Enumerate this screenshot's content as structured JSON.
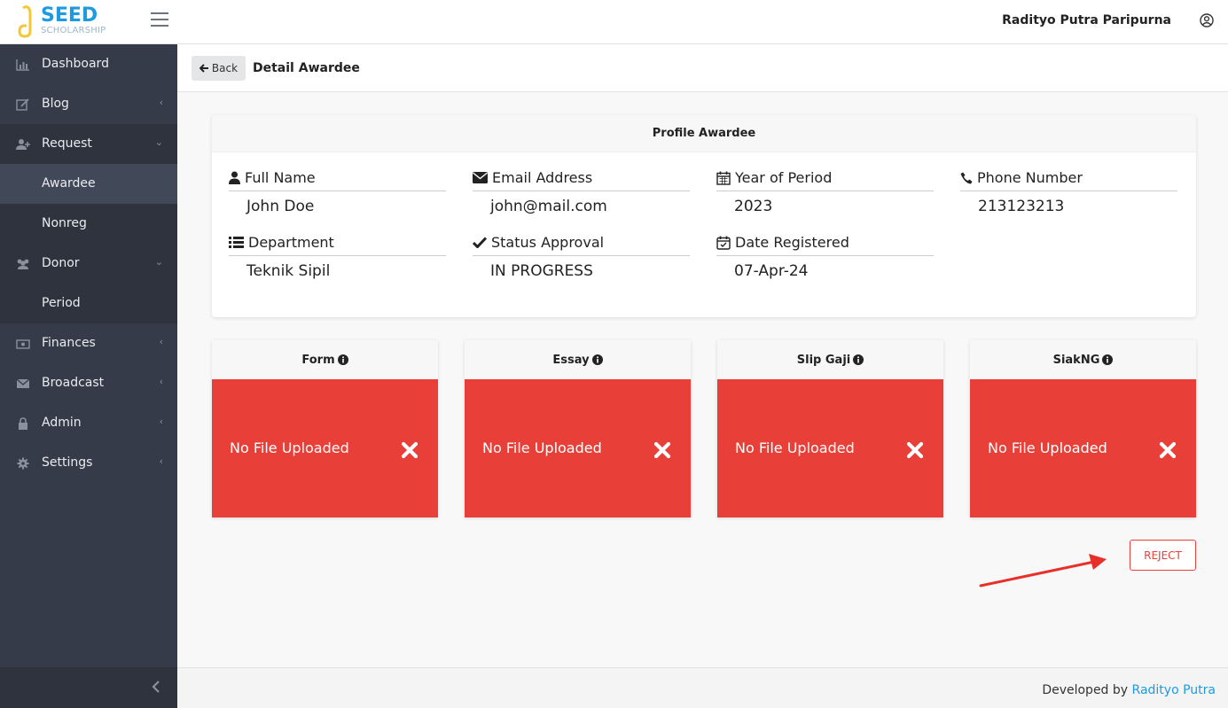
{
  "header": {
    "logo_main": "SEED",
    "logo_sub": "SCHOLARSHIP",
    "user_name": "Radityo Putra Paripurna"
  },
  "sidebar": {
    "items": [
      {
        "label": "Dashboard",
        "icon": "bar-chart-icon"
      },
      {
        "label": "Blog",
        "icon": "edit-icon"
      },
      {
        "label": "Request",
        "icon": "user-plus-icon"
      },
      {
        "label": "Awardee"
      },
      {
        "label": "Nonreg"
      },
      {
        "label": "Donor",
        "icon": "users-icon"
      },
      {
        "label": "Period"
      },
      {
        "label": "Finances",
        "icon": "money-icon"
      },
      {
        "label": "Broadcast",
        "icon": "envelope-icon"
      },
      {
        "label": "Admin",
        "icon": "lock-icon"
      },
      {
        "label": "Settings",
        "icon": "gear-icon"
      }
    ]
  },
  "subheader": {
    "back_label": "Back",
    "title": "Detail Awardee"
  },
  "profile": {
    "title": "Profile Awardee",
    "fields": [
      {
        "label": "Full Name",
        "value": "John Doe",
        "icon": "user-icon"
      },
      {
        "label": "Email Address",
        "value": "john@mail.com",
        "icon": "envelope-icon"
      },
      {
        "label": "Year of Period",
        "value": "2023",
        "icon": "calendar-icon"
      },
      {
        "label": "Phone Number",
        "value": "213123213",
        "icon": "phone-icon"
      },
      {
        "label": "Department",
        "value": "Teknik Sipil",
        "icon": "list-icon"
      },
      {
        "label": "Status Approval",
        "value": "IN PROGRESS",
        "icon": "check-icon"
      },
      {
        "label": "Date Registered",
        "value": "07-Apr-24",
        "icon": "calendar-check-icon"
      }
    ]
  },
  "documents": [
    {
      "title": "Form",
      "status": "No File Uploaded"
    },
    {
      "title": "Essay",
      "status": "No File Uploaded"
    },
    {
      "title": "Slip Gaji",
      "status": "No File Uploaded"
    },
    {
      "title": "SiakNG",
      "status": "No File Uploaded"
    }
  ],
  "actions": {
    "reject_label": "REJECT"
  },
  "footer": {
    "prefix": "Developed by",
    "author": "Radityo Putra"
  },
  "colors": {
    "sidebar": "#353b48",
    "danger": "#e84039",
    "accent": "#1e9be0"
  }
}
